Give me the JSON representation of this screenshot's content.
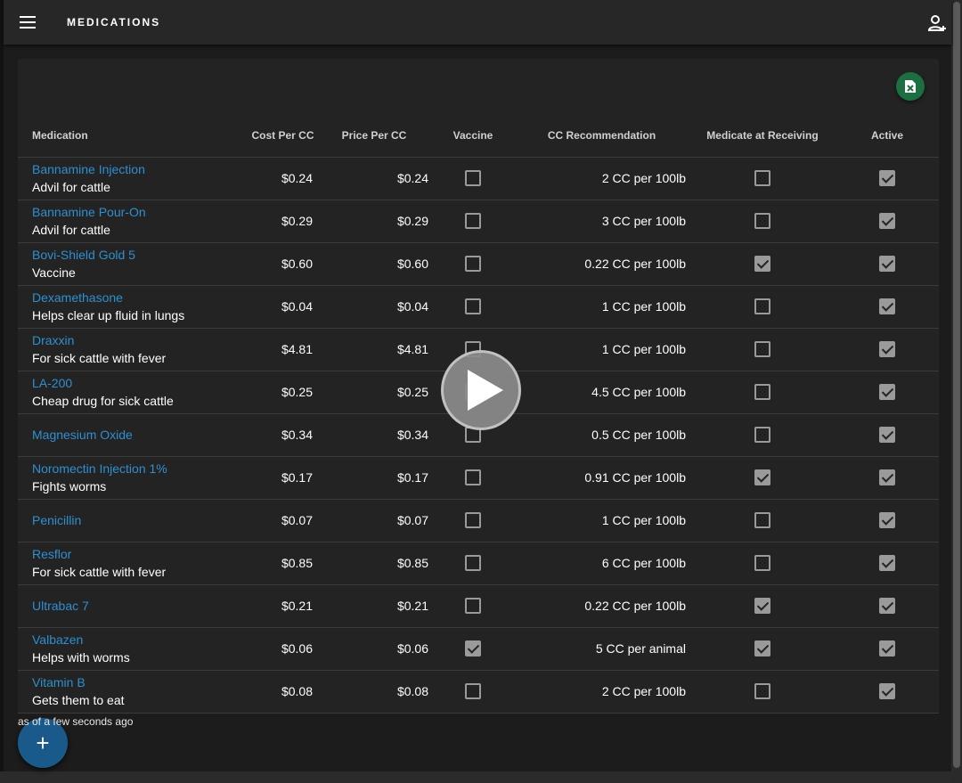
{
  "app": {
    "title": "MEDICATIONS"
  },
  "icons": {
    "menu": "menu-icon",
    "user": "account-plus-icon",
    "export": "excel-icon",
    "add": "plus-icon",
    "play": "play-icon"
  },
  "colors": {
    "link": "#2f8fd0",
    "excel": "#1d6f42",
    "fab": "#1a5a8a"
  },
  "table": {
    "headers": {
      "medication": "Medication",
      "cost": "Cost Per CC",
      "price": "Price Per CC",
      "vaccine": "Vaccine",
      "cc": "CC Recommendation",
      "receiving": "Medicate at Receiving",
      "active": "Active"
    },
    "rows": [
      {
        "name": "Bannamine Injection",
        "desc": "Advil for cattle",
        "cost": "$0.24",
        "price": "$0.24",
        "vaccine": false,
        "cc": "2 CC per 100lb",
        "receiving": false,
        "active": true
      },
      {
        "name": "Bannamine Pour-On",
        "desc": "Advil for cattle",
        "cost": "$0.29",
        "price": "$0.29",
        "vaccine": false,
        "cc": "3 CC per 100lb",
        "receiving": false,
        "active": true
      },
      {
        "name": "Bovi-Shield Gold 5",
        "desc": "Vaccine",
        "cost": "$0.60",
        "price": "$0.60",
        "vaccine": false,
        "cc": "0.22 CC per 100lb",
        "receiving": true,
        "active": true
      },
      {
        "name": "Dexamethasone",
        "desc": "Helps clear up fluid in lungs",
        "cost": "$0.04",
        "price": "$0.04",
        "vaccine": false,
        "cc": "1 CC per 100lb",
        "receiving": false,
        "active": true
      },
      {
        "name": "Draxxin",
        "desc": "For sick cattle with fever",
        "cost": "$4.81",
        "price": "$4.81",
        "vaccine": false,
        "cc": "1 CC per 100lb",
        "receiving": false,
        "active": true
      },
      {
        "name": "LA-200",
        "desc": "Cheap drug for sick cattle",
        "cost": "$0.25",
        "price": "$0.25",
        "vaccine": false,
        "cc": "4.5 CC per 100lb",
        "receiving": false,
        "active": true
      },
      {
        "name": "Magnesium Oxide",
        "desc": "",
        "cost": "$0.34",
        "price": "$0.34",
        "vaccine": false,
        "cc": "0.5 CC per 100lb",
        "receiving": false,
        "active": true
      },
      {
        "name": "Noromectin Injection 1%",
        "desc": "Fights worms",
        "cost": "$0.17",
        "price": "$0.17",
        "vaccine": false,
        "cc": "0.91 CC per 100lb",
        "receiving": true,
        "active": true
      },
      {
        "name": "Penicillin",
        "desc": "",
        "cost": "$0.07",
        "price": "$0.07",
        "vaccine": false,
        "cc": "1 CC per 100lb",
        "receiving": false,
        "active": true
      },
      {
        "name": "Resflor",
        "desc": "For sick cattle with fever",
        "cost": "$0.85",
        "price": "$0.85",
        "vaccine": false,
        "cc": "6 CC per 100lb",
        "receiving": false,
        "active": true
      },
      {
        "name": "Ultrabac 7",
        "desc": "",
        "cost": "$0.21",
        "price": "$0.21",
        "vaccine": false,
        "cc": "0.22 CC per 100lb",
        "receiving": true,
        "active": true
      },
      {
        "name": "Valbazen",
        "desc": "Helps with worms",
        "cost": "$0.06",
        "price": "$0.06",
        "vaccine": true,
        "cc": "5 CC per animal",
        "receiving": true,
        "active": true
      },
      {
        "name": "Vitamin B",
        "desc": "Gets them to eat",
        "cost": "$0.08",
        "price": "$0.08",
        "vaccine": false,
        "cc": "2 CC per 100lb",
        "receiving": false,
        "active": true
      }
    ]
  },
  "status": {
    "text": "as of a few seconds ago"
  },
  "fab": {
    "label": "+"
  }
}
